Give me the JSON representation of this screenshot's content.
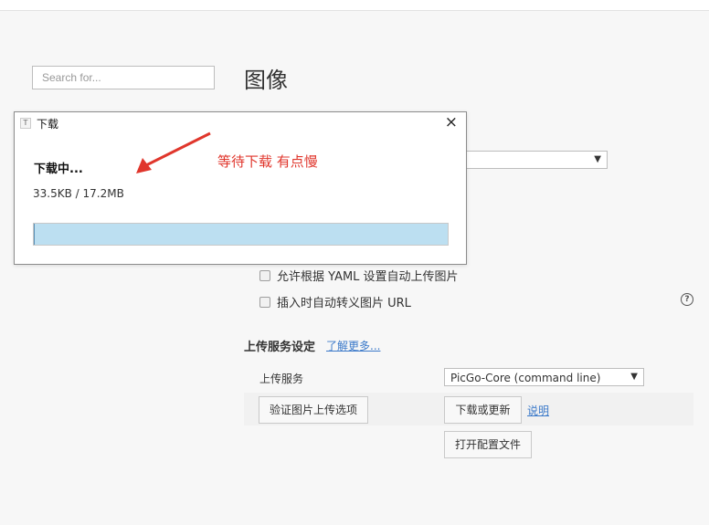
{
  "search": {
    "placeholder": "Search for..."
  },
  "page": {
    "title": "图像"
  },
  "options": [
    {
      "label": "允许根据 YAML 设置自动上传图片"
    },
    {
      "label": "插入时自动转义图片 URL"
    }
  ],
  "help": {
    "glyph": "?"
  },
  "upload": {
    "section_title": "上传服务设定",
    "learn_more": "了解更多...",
    "service_label": "上传服务",
    "service_value": "PicGo-Core (command line)",
    "verify_button": "验证图片上传选项",
    "download_button": "下载或更新",
    "explain_link": "说明",
    "open_config_button": "打开配置文件"
  },
  "dialog": {
    "icon_glyph": "T",
    "title": "下载",
    "close_glyph": "×",
    "status": "下载中...",
    "progress_text": "33.5KB / 17.2MB",
    "progress_fraction": 0.002
  },
  "annotation": {
    "text": "等待下载  有点慢"
  },
  "colors": {
    "annotation": "#e0362c",
    "link": "#3b79c9",
    "progress_fill": "#bcdff1"
  }
}
